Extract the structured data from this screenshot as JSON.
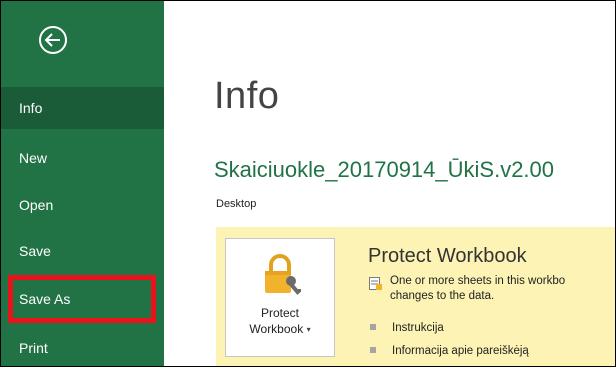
{
  "sidebar": {
    "back_icon": "back-arrow-circle-icon",
    "items": [
      {
        "label": "Info",
        "active": true
      },
      {
        "label": "New"
      },
      {
        "label": "Open"
      },
      {
        "label": "Save"
      },
      {
        "label": "Save As",
        "highlighted": true
      },
      {
        "label": "Print"
      }
    ],
    "colors": {
      "background": "#217346",
      "active": "#1a5c38",
      "highlight_border": "#e8131b"
    }
  },
  "main": {
    "title": "Info",
    "file_name": "Skaiciuokle_20170914_ŪkiS.v2.00",
    "file_location": "Desktop",
    "protect": {
      "button_line1": "Protect",
      "button_line2": "Workbook",
      "button_caret": "▾",
      "button_icon": "lock-key-icon",
      "heading": "Protect Workbook",
      "desc_line1": "One or more sheets in this workbo",
      "desc_line2": "changes to the data.",
      "warn_icon": "sheet-lock-icon",
      "sheets": [
        "Instrukcija",
        "Informacija apie pareiškėją"
      ],
      "panel_color": "#fcf3b5"
    }
  }
}
